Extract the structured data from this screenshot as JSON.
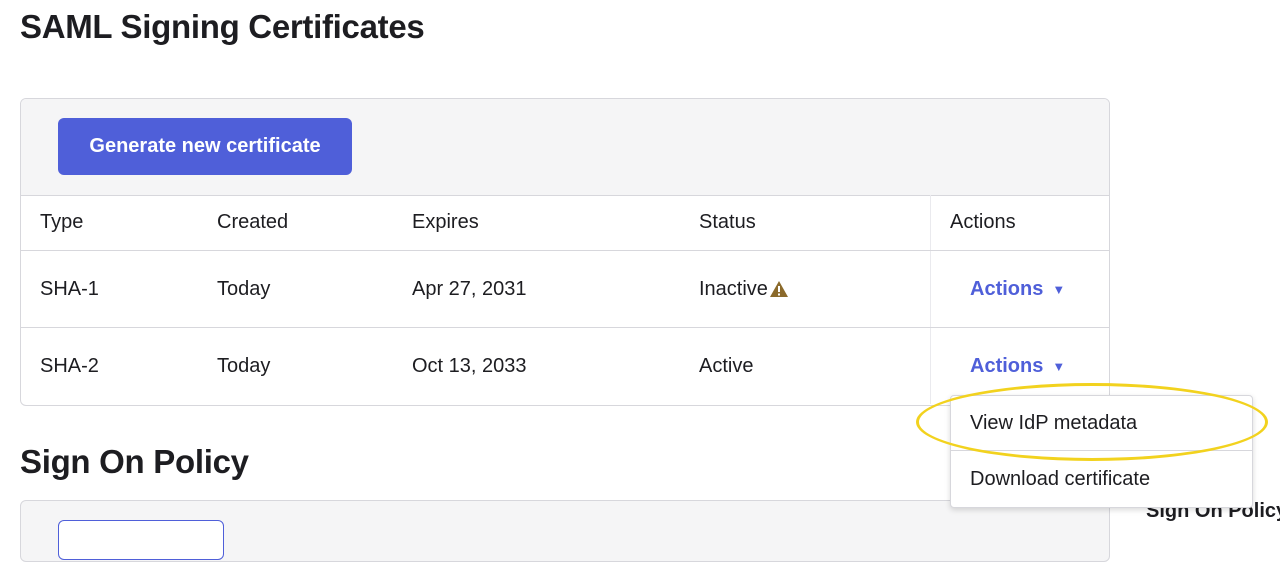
{
  "page": {
    "title": "SAML Signing Certificates",
    "section2_title": "Sign On Policy",
    "side_label": "Sign On Policy"
  },
  "toolbar": {
    "generate_label": "Generate new certificate"
  },
  "table": {
    "headers": [
      "Type",
      "Created",
      "Expires",
      "Status",
      "Actions"
    ],
    "rows": [
      {
        "type": "SHA-1",
        "created": "Today",
        "expires": "Apr 27, 2031",
        "status": "Inactive",
        "status_icon": "warning-icon",
        "actions": "Actions"
      },
      {
        "type": "SHA-2",
        "created": "Today",
        "expires": "Oct 13, 2033",
        "status": "Active",
        "actions": "Actions"
      }
    ]
  },
  "dropdown": {
    "items": [
      "View IdP metadata",
      "Download certificate"
    ]
  },
  "colors": {
    "accent": "#4f5fd9",
    "warning": "#8b6a2b",
    "highlight": "#f2d21e"
  }
}
